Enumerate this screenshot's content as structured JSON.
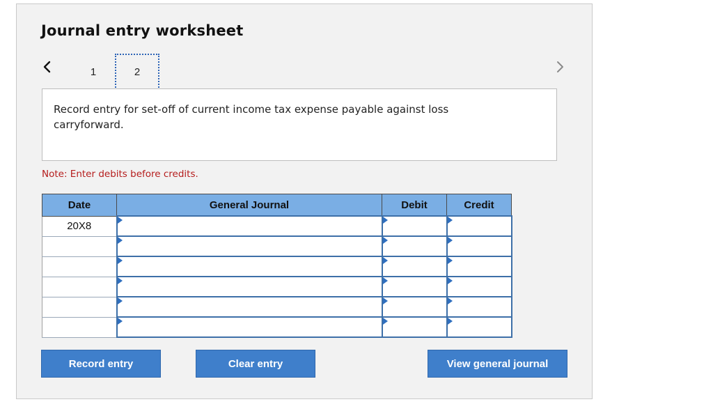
{
  "worksheet": {
    "title": "Journal entry worksheet"
  },
  "navigation": {
    "prev_icon": "chevron-left-icon",
    "next_icon": "chevron-right-icon",
    "steps": [
      {
        "label": "1",
        "active": false
      },
      {
        "label": "2",
        "active": true
      }
    ]
  },
  "instruction": {
    "text": "Record entry for set-off of current income tax expense payable against loss carryforward."
  },
  "note": {
    "text": "Note: Enter debits before credits."
  },
  "journal_table": {
    "headers": {
      "date": "Date",
      "general_journal": "General Journal",
      "debit": "Debit",
      "credit": "Credit"
    },
    "rows": [
      {
        "date": "20X8",
        "account": "",
        "debit": "",
        "credit": ""
      },
      {
        "date": "",
        "account": "",
        "debit": "",
        "credit": ""
      },
      {
        "date": "",
        "account": "",
        "debit": "",
        "credit": ""
      },
      {
        "date": "",
        "account": "",
        "debit": "",
        "credit": ""
      },
      {
        "date": "",
        "account": "",
        "debit": "",
        "credit": ""
      },
      {
        "date": "",
        "account": "",
        "debit": "",
        "credit": ""
      }
    ]
  },
  "buttons": {
    "record": "Record entry",
    "clear": "Clear entry",
    "view": "View general journal"
  },
  "colors": {
    "header_blue": "#7aaee4",
    "button_blue": "#3f7fcb",
    "note_red": "#b51c1c",
    "panel_gray": "#f2f2f2"
  }
}
